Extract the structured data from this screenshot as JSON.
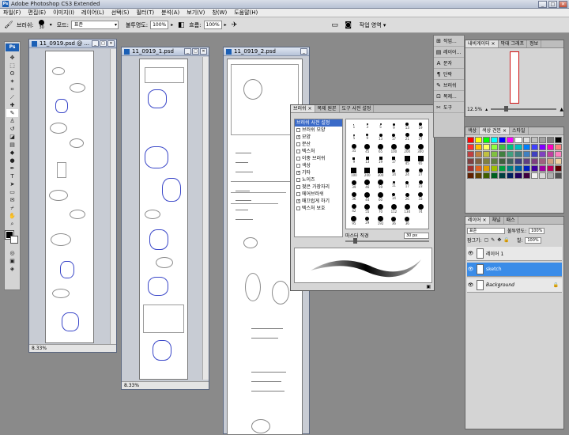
{
  "window": {
    "title": "Adobe Photoshop CS3 Extended",
    "min": "_",
    "max": "□",
    "close": "✕"
  },
  "menu": [
    "파일(F)",
    "편집(E)",
    "이미지(I)",
    "레이어(L)",
    "선택(S)",
    "필터(T)",
    "분석(A)",
    "보기(V)",
    "창(W)",
    "도움말(H)"
  ],
  "options": {
    "brush_label": "브러쉬:",
    "brush_size": "30",
    "mode_label": "모드:",
    "mode_value": "표준",
    "opacity_label": "불투명도:",
    "opacity_value": "100%",
    "flow_label": "흐름:",
    "flow_value": "100%",
    "workspace": "작업 영역 ▾"
  },
  "documents": [
    {
      "title": "11_0919.psd @ ...",
      "zoom": "8.33%"
    },
    {
      "title": "11_0919_1.psd",
      "zoom": "8.33%"
    },
    {
      "title": "11_0919_2.psd"
    }
  ],
  "brush_panel": {
    "tabs": [
      "브러쉬 ×",
      "복제 원본",
      "도구 사전 설정"
    ],
    "list": [
      {
        "label": "브러쉬 사전 설정",
        "header": true
      },
      {
        "label": "브러쉬 모양",
        "cb": ""
      },
      {
        "label": "모양",
        "cb": "✓"
      },
      {
        "label": "분산",
        "cb": ""
      },
      {
        "label": "텍스처",
        "cb": ""
      },
      {
        "label": "이중 브러쉬",
        "cb": ""
      },
      {
        "label": "색상",
        "cb": ""
      },
      {
        "label": "기타",
        "cb": "✓"
      },
      {
        "label": "노이즈",
        "cb": ""
      },
      {
        "label": "젖은 가장자리",
        "cb": ""
      },
      {
        "label": "에어브러쉬",
        "cb": ""
      },
      {
        "label": "매끄럽게 하기",
        "cb": "✓"
      },
      {
        "label": "텍스처 보호",
        "cb": ""
      }
    ],
    "sizes": [
      "1",
      "3",
      "5",
      "9",
      "13",
      "19",
      "5",
      "9",
      "13",
      "17",
      "21",
      "27",
      "35",
      "45",
      "65",
      "100",
      "200",
      "300",
      "9",
      "13",
      "19",
      "17",
      "45",
      "65",
      "100",
      "200",
      "300",
      "14",
      "24",
      "27",
      "39",
      "46",
      "59",
      "11",
      "17",
      "23",
      "36",
      "44",
      "60",
      "14",
      "26",
      "33",
      "42",
      "55",
      "70",
      "112",
      "134",
      "74",
      "95",
      "29",
      "192",
      "36",
      "36"
    ],
    "master_label": "마스터 직경",
    "master_value": "30 px"
  },
  "dock": [
    {
      "icon": "⊞",
      "label": "작업..."
    },
    {
      "icon": "▤",
      "label": "레이어..."
    },
    {
      "icon": "A",
      "label": "문자"
    },
    {
      "icon": "¶",
      "label": "단락"
    },
    {
      "icon": "✎",
      "label": "브러쉬"
    },
    {
      "icon": "⊡",
      "label": "복제..."
    },
    {
      "icon": "✂",
      "label": "도구"
    }
  ],
  "navigator": {
    "tabs": [
      "내비게이터 ×",
      "막대 그래프",
      "정보"
    ],
    "zoom": "12.5%"
  },
  "swatches": {
    "tabs": [
      "색상",
      "색상 견본 ×",
      "스타일"
    ]
  },
  "layers": {
    "tabs": [
      "레이어 ×",
      "채널",
      "패스"
    ],
    "blend": "표준",
    "opacity_label": "불투명도:",
    "opacity": "100%",
    "lock_label": "잠그기:",
    "fill_label": "칠:",
    "fill": "100%",
    "items": [
      {
        "name": "레이어 1",
        "selected": false
      },
      {
        "name": "sketch",
        "selected": true
      },
      {
        "name": "Background",
        "selected": false
      }
    ]
  },
  "colors": {
    "swatches": [
      "#ff0000",
      "#ffff00",
      "#00ff00",
      "#00ffff",
      "#0000ff",
      "#ff00ff",
      "#ffffff",
      "#e0e0e0",
      "#c0c0c0",
      "#a0a0a0",
      "#808080",
      "#000000",
      "#ff3030",
      "#ffc000",
      "#ffff60",
      "#90ff40",
      "#40c040",
      "#00c080",
      "#00c0c0",
      "#0080ff",
      "#4040ff",
      "#8000ff",
      "#ff00c0",
      "#ff8080",
      "#c04040",
      "#c08040",
      "#c0c040",
      "#80c040",
      "#408040",
      "#40a080",
      "#408080",
      "#4080c0",
      "#4040c0",
      "#8040c0",
      "#c040a0",
      "#ff80c0",
      "#804040",
      "#806040",
      "#808040",
      "#608040",
      "#406040",
      "#406060",
      "#404080",
      "#604080",
      "#804080",
      "#a06080",
      "#d0a080",
      "#f0d0a0",
      "#a03030",
      "#e06020",
      "#e0a000",
      "#a0c000",
      "#00a040",
      "#008080",
      "#0060a0",
      "#0020c0",
      "#4000a0",
      "#a000a0",
      "#c00060",
      "#600000",
      "#602000",
      "#604000",
      "#406000",
      "#006020",
      "#004040",
      "#002060",
      "#200060",
      "#400040",
      "#f0f0f0",
      "#d8d8d8",
      "#b0b0b0",
      "#505050"
    ]
  }
}
